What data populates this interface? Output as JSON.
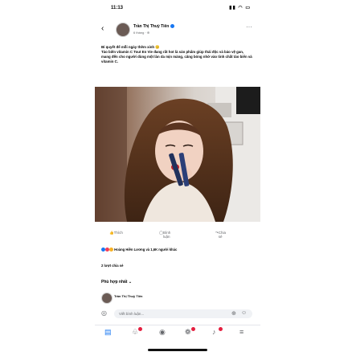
{
  "status": {
    "time": "11:13",
    "icons": "▮▮ ◠ ▭"
  },
  "header": {
    "back": "‹",
    "author": "Trần Thị Thuỳ Tiên",
    "meta": "6 tháng · ⊕",
    "more": "···"
  },
  "post": {
    "caption_line1": "Bí quyết để mỗi ngày thêm xinh 😊",
    "caption_body": "Tảo biển vitamin C Tout En Vie đang rất hot là sản phẩm giúp thải độc và bảo vệ gan, mang đến cho người dùng một làn da mịn màng, căng bóng nhờ vào tinh chất tảo biển và vitamin C."
  },
  "actions": {
    "like": "Thích",
    "comment": "Bình luận",
    "share": "Chia sẻ"
  },
  "reactions_text": "Hoàng Hiền Lương và 1,6K người khác",
  "shares_text": "2 lượt chia sẻ",
  "sort_label": "Phù hợp nhất ⌄",
  "comment_author": "Trần Thị Thuỳ Tiên",
  "input_placeholder": "Viết bình luận...",
  "colors": {
    "accent": "#1877f2",
    "like": "#1877f2",
    "love": "#f33e58",
    "haha": "#f7b125"
  }
}
